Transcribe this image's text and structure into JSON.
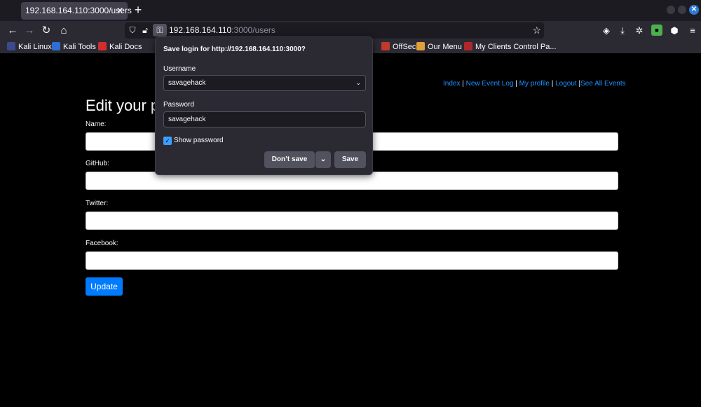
{
  "browser": {
    "tab_title": "192.168.164.110:3000/users",
    "tab_close": "✕",
    "new_tab": "+",
    "url_host": "192.168.164.110",
    "url_path": ":3000/users"
  },
  "bookmarks": [
    {
      "label": "Kali Linux",
      "color": "#3b4a8c"
    },
    {
      "label": "Kali Tools",
      "color": "#2d6fd3"
    },
    {
      "label": "Kali Docs",
      "color": "#d32d2d"
    },
    {
      "label": "OffSec",
      "color": "#c0392b"
    },
    {
      "label": "Our Menu",
      "color": "#e0a03a"
    },
    {
      "label": "My Clients Control Pa...",
      "color": "#b0282c"
    }
  ],
  "popup": {
    "title": "Save login for http://192.168.164.110:3000?",
    "username_label": "Username",
    "username_value": "savagehack",
    "password_label": "Password",
    "password_value": "savagehack",
    "show_password": "Show password",
    "dont_save": "Don’t save",
    "save": "Save"
  },
  "page": {
    "nav": {
      "index": "Index",
      "new_event_log": "New Event Log",
      "my_profile": "My profile",
      "logout": "Logout",
      "see_all_events": "See All Events",
      "sep": " | ",
      "sep_last": " |"
    },
    "heading": "Edit your p",
    "name_label": "Name:",
    "github_label": "GitHub:",
    "twitter_label": "Twitter:",
    "facebook_label": "Facebook:",
    "update_button": "Update"
  }
}
